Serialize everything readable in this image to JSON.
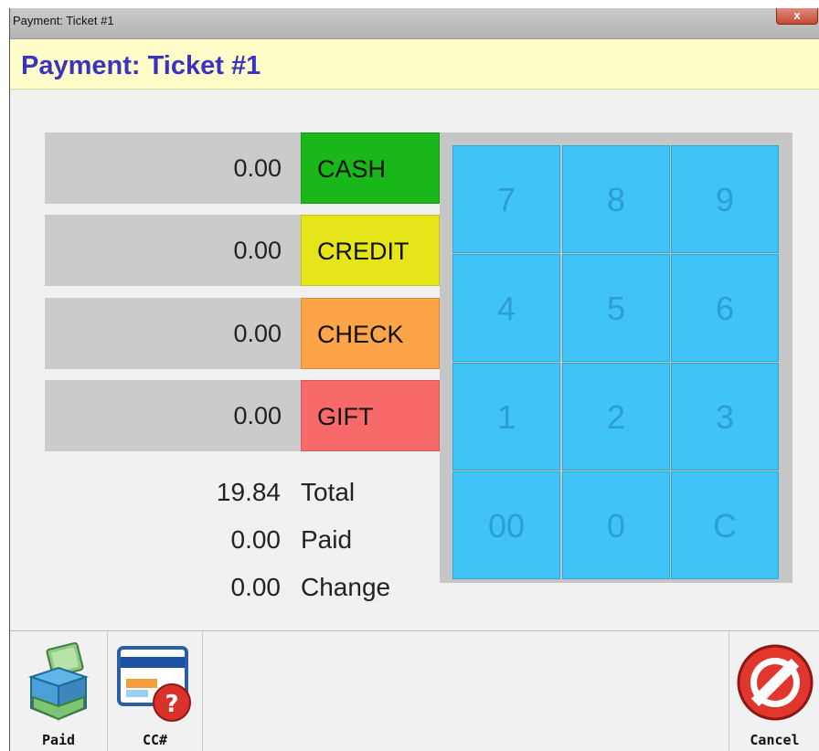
{
  "window": {
    "title": "Payment: Ticket #1",
    "close_glyph": "x"
  },
  "header": {
    "title": "Payment: Ticket #1"
  },
  "payments": [
    {
      "amount": "0.00",
      "label": "CASH",
      "color": "#19b719"
    },
    {
      "amount": "0.00",
      "label": "CREDIT",
      "color": "#e6e519"
    },
    {
      "amount": "0.00",
      "label": "CHECK",
      "color": "#fba448"
    },
    {
      "amount": "0.00",
      "label": "GIFT",
      "color": "#f86a6a"
    }
  ],
  "summary": {
    "total": {
      "value": "19.84",
      "label": "Total"
    },
    "paid": {
      "value": "0.00",
      "label": "Paid"
    },
    "change": {
      "value": "0.00",
      "label": "Change"
    }
  },
  "keypad": {
    "keys": [
      "7",
      "8",
      "9",
      "4",
      "5",
      "6",
      "1",
      "2",
      "3",
      "00",
      "0",
      "C"
    ],
    "color": "#40c3f6"
  },
  "toolbar": {
    "paid_label": "Paid",
    "cc_label": "CC#",
    "cancel_label": "Cancel",
    "paid_icon": "cash-register-icon",
    "cc_icon": "credit-card-help-icon",
    "cancel_icon": "cancel-icon"
  }
}
